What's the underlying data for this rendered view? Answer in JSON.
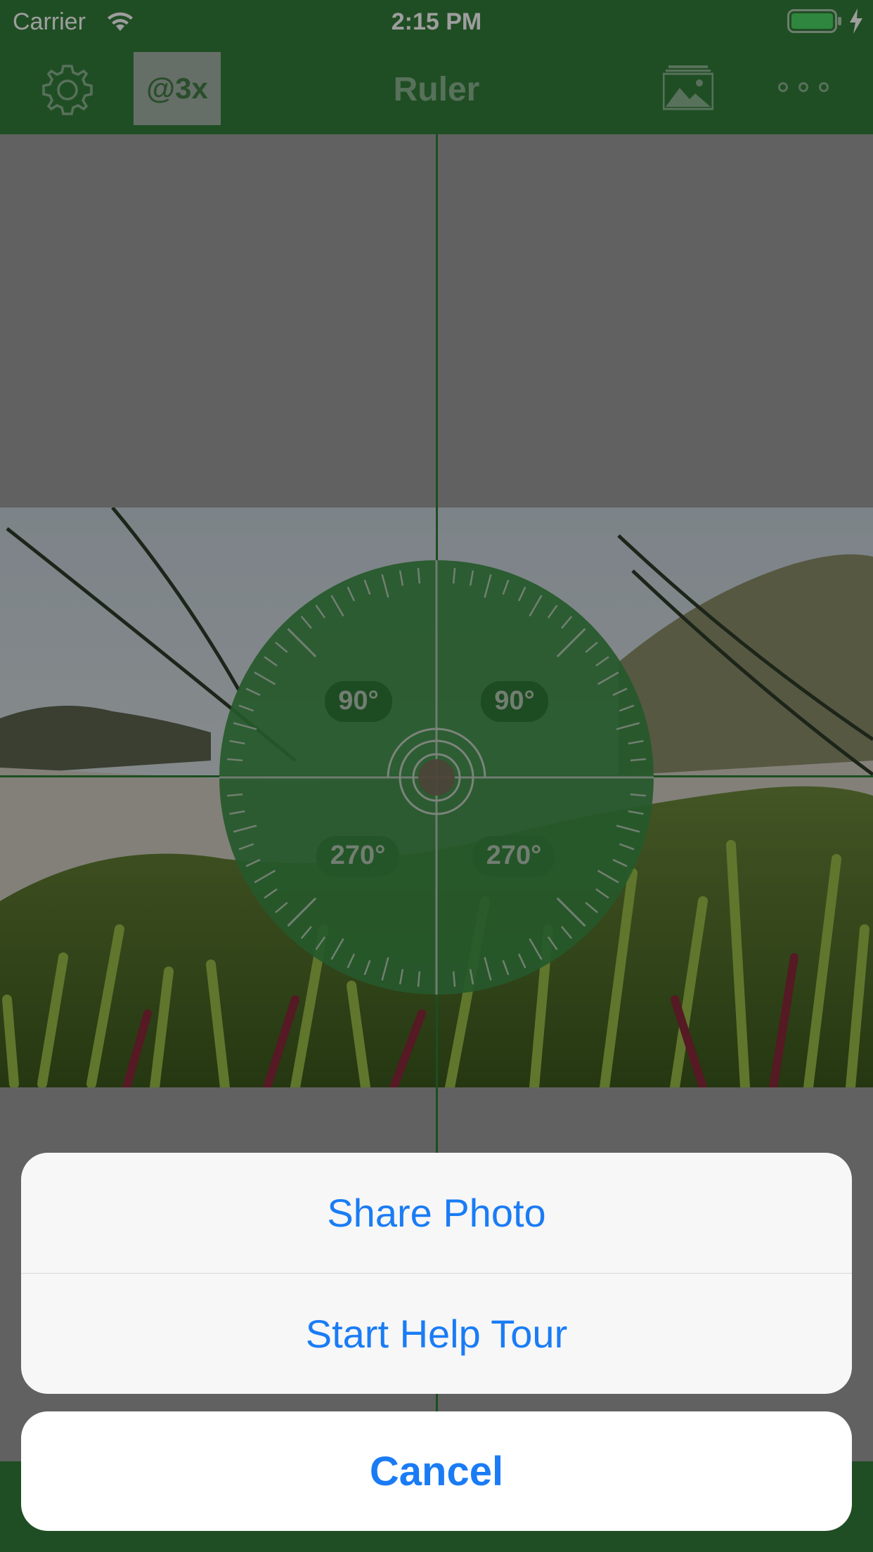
{
  "status_bar": {
    "carrier": "Carrier",
    "time": "2:15 PM",
    "battery_level": 1.0,
    "charging": true
  },
  "nav_bar": {
    "title": "Ruler",
    "scale_label": "@3x",
    "left_icon": "gear-icon",
    "right_icons": [
      "photo-icon",
      "more-icon"
    ]
  },
  "protractor": {
    "label_top_left": "90°",
    "label_top_right": "90°",
    "label_bottom_left": "270°",
    "label_bottom_right": "270°",
    "color": "#3d8f45"
  },
  "action_sheet": {
    "items": [
      {
        "label": "Share Photo"
      },
      {
        "label": "Start Help Tour"
      }
    ],
    "cancel_label": "Cancel"
  },
  "colors": {
    "brand_green": "#357e3b",
    "action_blue": "#1a7cf5"
  }
}
